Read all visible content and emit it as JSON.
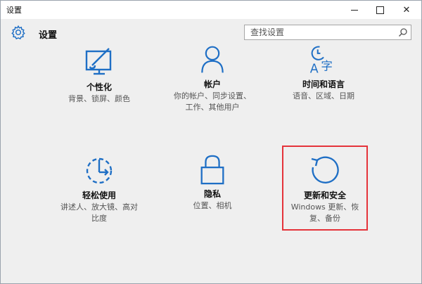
{
  "window": {
    "title": "设置",
    "controls": {
      "minimize": "minimize",
      "maximize": "maximize",
      "close": "✕"
    }
  },
  "header": {
    "title": "设置",
    "search_placeholder": "查找设置"
  },
  "tiles": [
    {
      "id": "personalization",
      "title": "个性化",
      "desc": [
        "背景、锁屏、颜色"
      ],
      "icon": "personalization-icon"
    },
    {
      "id": "accounts",
      "title": "帐户",
      "desc": [
        "你的帐户、同步设置、",
        "工作、其他用户"
      ],
      "icon": "account-icon"
    },
    {
      "id": "time-language",
      "title": "时间和语言",
      "desc": [
        "语音、区域、日期"
      ],
      "icon": "time-language-icon"
    },
    {
      "id": "ease-of-access",
      "title": "轻松使用",
      "desc": [
        "讲述人、放大镜、高对",
        "比度"
      ],
      "icon": "ease-of-access-icon"
    },
    {
      "id": "privacy",
      "title": "隐私",
      "desc": [
        "位置、相机"
      ],
      "icon": "lock-icon"
    },
    {
      "id": "update-security",
      "title": "更新和安全",
      "desc": [
        "Windows 更新、恢",
        "复、备份"
      ],
      "icon": "update-icon"
    }
  ],
  "colors": {
    "accent": "#1f6fc5",
    "highlight_border": "#e5333a",
    "background": "#efefef"
  }
}
